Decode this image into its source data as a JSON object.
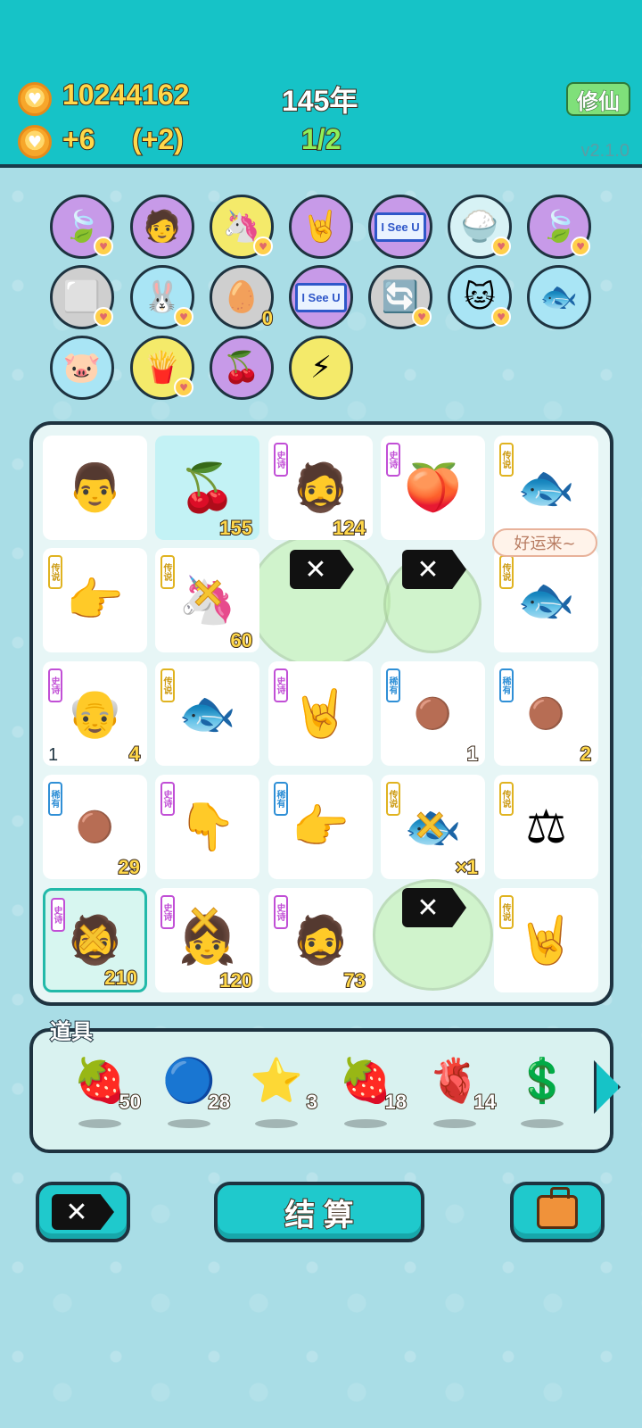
{
  "header": {
    "money": "10244162",
    "income": "+6",
    "income_bonus": "(+2)",
    "year": "145年",
    "progress": "1/2",
    "xiuxian_button": "修仙",
    "version": "v2.1.0"
  },
  "owned_items": [
    {
      "icon": "leaf-icon",
      "glyph": "🍃"
    },
    {
      "icon": "sunglasses-face-icon",
      "glyph": "🧑"
    },
    {
      "icon": "unicorn-icon",
      "glyph": "🦄"
    },
    {
      "icon": "rock-hand-icon",
      "glyph": "🤘"
    },
    {
      "icon": "i-see-u-sign-icon",
      "text": "I See U"
    },
    {
      "icon": "rice-bowl-icon",
      "glyph": "🍚"
    },
    {
      "icon": "leaf-icon",
      "glyph": "🍃"
    },
    {
      "icon": "sugar-cubes-icon",
      "glyph": "⬜"
    },
    {
      "icon": "rabbit-icon",
      "glyph": "🐰"
    },
    {
      "icon": "egg-tray-icon",
      "glyph": "🥚",
      "count": "0"
    },
    {
      "icon": "i-see-u-sign-icon",
      "text": "I See U"
    },
    {
      "icon": "refresh-icon",
      "glyph": "🔄"
    },
    {
      "icon": "cat-icon",
      "glyph": "🐱"
    },
    {
      "icon": "fishbowl-icon",
      "glyph": "🐟"
    },
    {
      "icon": "piggy-bank-icon",
      "glyph": "🐷"
    },
    {
      "icon": "fries-icon",
      "glyph": "🍟"
    },
    {
      "icon": "eyepatch-longan-icon",
      "glyph": "🍒"
    },
    {
      "icon": "lightning-icon",
      "glyph": "⚡"
    }
  ],
  "board": {
    "bubble": "好运来~",
    "tags": {
      "epic": "史诗",
      "legend": "传说",
      "rare": "稀有"
    },
    "cells": [
      {
        "icon": "man-face-icon",
        "glyph": "👨"
      },
      {
        "icon": "cherries-icon",
        "glyph": "🍒",
        "num": "155"
      },
      {
        "icon": "green-hat-man-icon",
        "glyph": "🧔",
        "tag": "史诗",
        "num": "124"
      },
      {
        "icon": "peach-icon",
        "glyph": "🍑",
        "tag": "史诗"
      },
      {
        "icon": "koi-fish-icon",
        "glyph": "🐟",
        "tag": "传说"
      },
      {
        "icon": "pointing-hand-icon",
        "glyph": "👉",
        "tag": "传说"
      },
      {
        "icon": "unicorn-icon",
        "glyph": "🦄",
        "tag": "传说",
        "num": "60"
      },
      {
        "icon": "eliminate-flag-icon"
      },
      {
        "icon": "eliminate-flag-icon"
      },
      {
        "icon": "koi-fish-icon",
        "glyph": "🐟",
        "tag": "传说"
      },
      {
        "icon": "old-man-icon",
        "glyph": "👴",
        "tag": "史诗",
        "num": "4",
        "numl": "1"
      },
      {
        "icon": "koi-fish-icon",
        "glyph": "🐟",
        "tag": "传说"
      },
      {
        "icon": "rock-hand-icon",
        "glyph": "🤘",
        "tag": "史诗"
      },
      {
        "icon": "longan-icon",
        "glyph": "🟤",
        "tag": "稀有",
        "num": "1"
      },
      {
        "icon": "longan-icon",
        "glyph": "🟤",
        "tag": "稀有",
        "num": "2"
      },
      {
        "icon": "longan-icon",
        "glyph": "🟤",
        "tag": "稀有",
        "num": "29"
      },
      {
        "icon": "pointing-hand-icon",
        "glyph": "👇",
        "tag": "史诗"
      },
      {
        "icon": "dark-pointing-hand-icon",
        "glyph": "👉",
        "tag": "稀有"
      },
      {
        "icon": "koi-fish-icon",
        "glyph": "🐟",
        "tag": "传说",
        "num": "×1"
      },
      {
        "icon": "scales-icon",
        "glyph": "⚖",
        "tag": "传说"
      },
      {
        "icon": "green-hat-man-icon",
        "glyph": "🧔",
        "tag": "史诗",
        "num": "210"
      },
      {
        "icon": "girl-braids-icon",
        "glyph": "👧",
        "tag": "史诗",
        "num": "120"
      },
      {
        "icon": "green-hat-man-icon",
        "glyph": "🧔",
        "tag": "史诗",
        "num": "73"
      },
      {
        "icon": "eliminate-flag-icon"
      },
      {
        "icon": "rock-hand-icon",
        "glyph": "🤘",
        "tag": "传说"
      }
    ]
  },
  "props": {
    "label": "道具",
    "items": [
      {
        "icon": "lychee-icon",
        "glyph": "🍓",
        "count": "50"
      },
      {
        "icon": "blueberry-icon",
        "glyph": "🔵",
        "count": "28"
      },
      {
        "icon": "star-icon",
        "glyph": "⭐",
        "count": "3"
      },
      {
        "icon": "strawberry-icon",
        "glyph": "🍓",
        "count": "18"
      },
      {
        "icon": "liver-icon",
        "glyph": "🫀",
        "count": "14"
      },
      {
        "icon": "dollar-coin-icon",
        "glyph": "💲",
        "count": ""
      }
    ]
  },
  "buttons": {
    "settle": "结 算",
    "x_flag": "✕"
  }
}
